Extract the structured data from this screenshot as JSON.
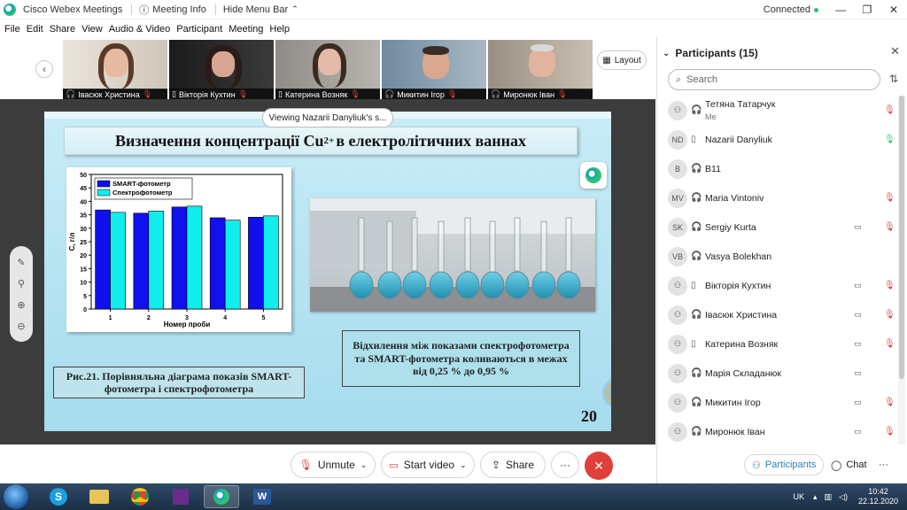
{
  "titlebar": {
    "app_name": "Cisco Webex Meetings",
    "meeting_info": "Meeting Info",
    "hide_menu": "Hide Menu Bar",
    "status": "Connected",
    "minimize": "—",
    "restore": "❐",
    "close": "✕"
  },
  "menu": [
    "File",
    "Edit",
    "Share",
    "View",
    "Audio & Video",
    "Participant",
    "Meeting",
    "Help"
  ],
  "strip": {
    "layout_label": "Layout",
    "thumbs": [
      {
        "name": "Івасюк Христина"
      },
      {
        "name": "Вікторія Кухтин"
      },
      {
        "name": "Катерина Возняк"
      },
      {
        "name": "Микитин Ігор"
      },
      {
        "name": "Миронюк Іван"
      }
    ]
  },
  "viewing_label": "Viewing Nazarii Danyliuk's s...",
  "slide": {
    "title_main": "Визначення концентрації Cu",
    "title_sup": "2+",
    "title_tail": "в електролітичних ваннах",
    "caption": "Рис.21. Порівняльна діаграма показів SMART-фотометра і спектрофотометра",
    "note": "Відхилення між показами спектрофотометра та SMART-фотометра коливаються в межах від 0,25 % до 0,95 %",
    "page_number": "20"
  },
  "chart_data": {
    "type": "bar",
    "categories": [
      "1",
      "2",
      "3",
      "4",
      "5"
    ],
    "series": [
      {
        "name": "SMART-фотометр",
        "values": [
          36.8,
          35.6,
          37.9,
          33.9,
          34.1
        ],
        "color": "#1010ee"
      },
      {
        "name": "Спектрофотометр",
        "values": [
          35.9,
          36.4,
          38.2,
          33.0,
          34.6
        ],
        "color": "#10eeee"
      }
    ],
    "xlabel": "Номер проби",
    "ylabel": "C, г/л",
    "ylim": [
      0,
      50
    ],
    "yticks": [
      0,
      5,
      10,
      15,
      20,
      25,
      30,
      35,
      40,
      45,
      50
    ],
    "legend": "top-left",
    "grid": false
  },
  "controls": {
    "unmute": "Unmute",
    "start_video": "Start video",
    "share": "Share",
    "more": "···"
  },
  "panel": {
    "title": "Participants (15)",
    "search_placeholder": "Search",
    "participants": [
      {
        "initials": "",
        "name": "Тетяна Татарчук",
        "sub": "Me",
        "device": "headset",
        "camera": false,
        "mic": "muted"
      },
      {
        "initials": "ND",
        "name": "Nazarii Danyliuk",
        "sub": "",
        "device": "phone",
        "camera": false,
        "mic": "active"
      },
      {
        "initials": "B",
        "name": "B11",
        "sub": "",
        "device": "headset",
        "camera": false,
        "mic": "none"
      },
      {
        "initials": "MV",
        "name": "Maria Vintoniv",
        "sub": "",
        "device": "headset",
        "camera": false,
        "mic": "muted"
      },
      {
        "initials": "SK",
        "name": "Sergiy Kurta",
        "sub": "",
        "device": "headset",
        "camera": true,
        "mic": "muted"
      },
      {
        "initials": "VB",
        "name": "Vasya Bolekhan",
        "sub": "",
        "device": "headset",
        "camera": false,
        "mic": "none"
      },
      {
        "initials": "",
        "name": "Вікторія Кухтин",
        "sub": "",
        "device": "phone",
        "camera": true,
        "mic": "muted"
      },
      {
        "initials": "",
        "name": "Івасюк Христина",
        "sub": "",
        "device": "headset",
        "camera": true,
        "mic": "muted"
      },
      {
        "initials": "",
        "name": "Катерина Возняк",
        "sub": "",
        "device": "phone",
        "camera": true,
        "mic": "muted"
      },
      {
        "initials": "",
        "name": "Марія Складанюк",
        "sub": "",
        "device": "headset",
        "camera": true,
        "mic": "none"
      },
      {
        "initials": "",
        "name": "Микитин Ігор",
        "sub": "",
        "device": "headset",
        "camera": true,
        "mic": "muted"
      },
      {
        "initials": "",
        "name": "Миронюк Іван",
        "sub": "",
        "device": "headset",
        "camera": true,
        "mic": "muted"
      }
    ],
    "participants_tab": "Participants",
    "chat_tab": "Chat",
    "more": "···"
  },
  "taskbar": {
    "lang": "UK",
    "time": "10:42",
    "date": "22.12.2020"
  },
  "colors": {
    "accent": "#2f7fb8",
    "end_call": "#e0403a",
    "muted": "#e0403a",
    "active_mic": "#2fbf71"
  }
}
